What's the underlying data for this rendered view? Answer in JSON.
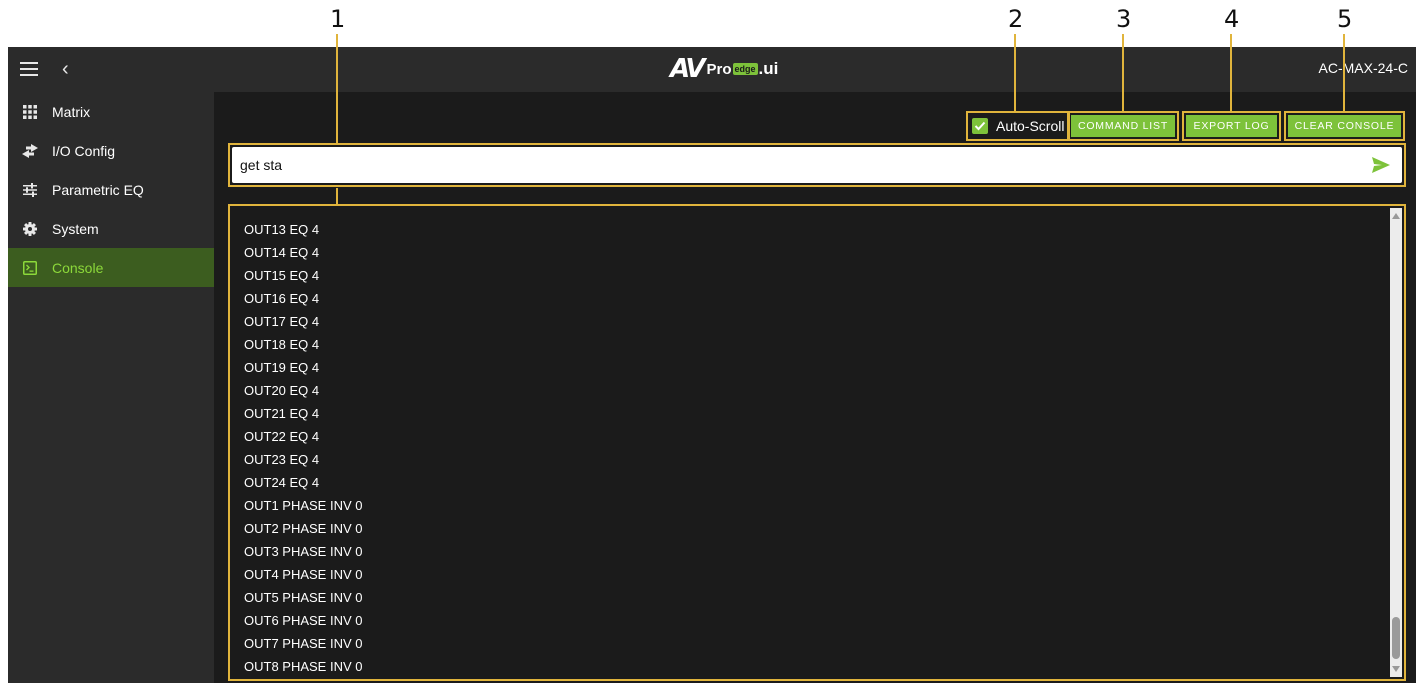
{
  "callouts": [
    "1",
    "2",
    "3",
    "4",
    "5"
  ],
  "header": {
    "logo_av": "AV",
    "logo_pro": "Pro",
    "logo_edge": "edge",
    "logo_ui": ".ui",
    "device_name": "AC-MAX-24-C"
  },
  "sidebar": {
    "items": [
      {
        "label": "Matrix",
        "icon": "grid-icon"
      },
      {
        "label": "I/O Config",
        "icon": "swap-arrows-icon"
      },
      {
        "label": "Parametric EQ",
        "icon": "sliders-icon"
      },
      {
        "label": "System",
        "icon": "gear-icon"
      },
      {
        "label": "Console",
        "icon": "terminal-icon"
      }
    ],
    "active_index": 4
  },
  "toolbar": {
    "autoscroll_label": "Auto-Scroll",
    "autoscroll_checked": true,
    "command_list_label": "COMMAND LIST",
    "export_log_label": "EXPORT LOG",
    "clear_console_label": "CLEAR CONSOLE"
  },
  "command": {
    "value": "get sta"
  },
  "console": {
    "lines": [
      "OUT13 EQ 4",
      "OUT14 EQ 4",
      "OUT15 EQ 4",
      "OUT16 EQ 4",
      "OUT17 EQ 4",
      "OUT18 EQ 4",
      "OUT19 EQ 4",
      "OUT20 EQ 4",
      "OUT21 EQ 4",
      "OUT22 EQ 4",
      "OUT23 EQ 4",
      "OUT24 EQ 4",
      "OUT1 PHASE INV 0",
      "OUT2 PHASE INV 0",
      "OUT3 PHASE INV 0",
      "OUT4 PHASE INV 0",
      "OUT5 PHASE INV 0",
      "OUT6 PHASE INV 0",
      "OUT7 PHASE INV 0",
      "OUT8 PHASE INV 0"
    ]
  },
  "colors": {
    "accent": "#7dc23a",
    "highlight_border": "#e0b43c",
    "header_bg": "#2b2b2b",
    "console_bg": "#1b1b1b",
    "active_nav_bg": "#3c5d1f"
  }
}
